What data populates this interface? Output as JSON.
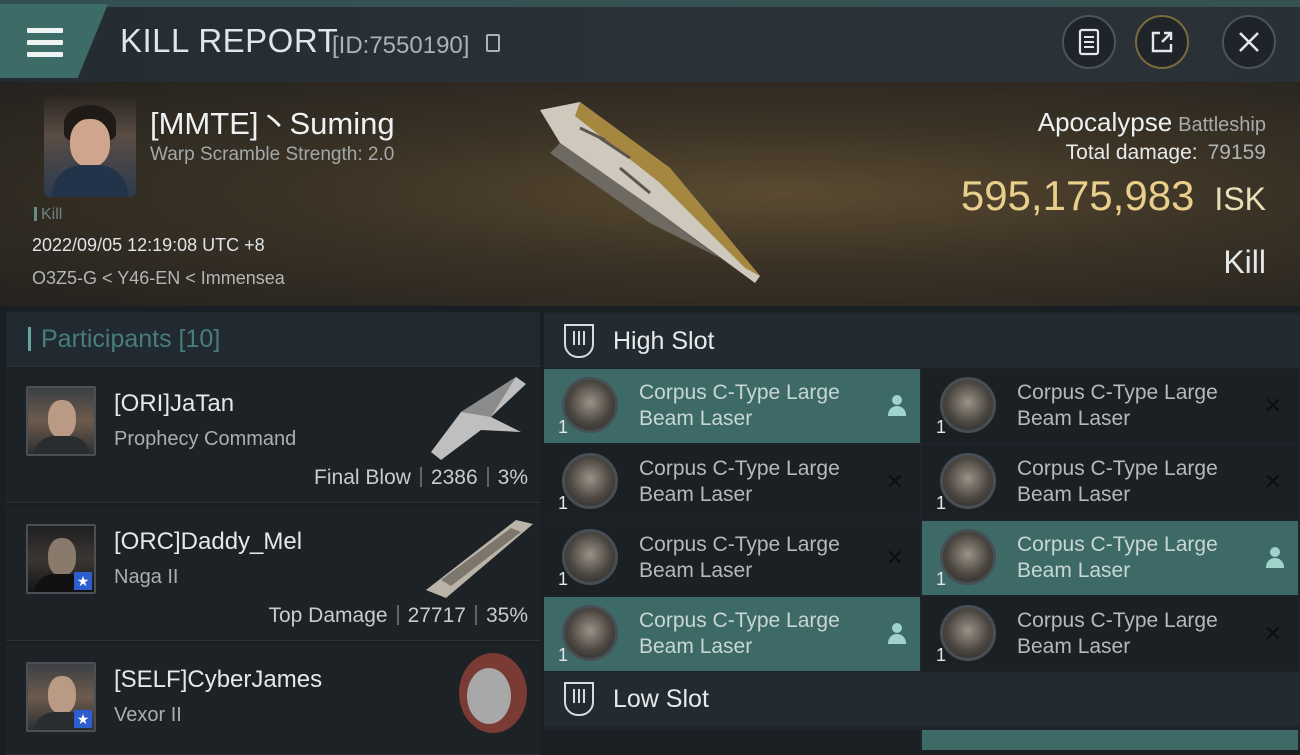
{
  "header": {
    "title": "KILL REPORT",
    "report_id": "[ID:7550190]",
    "icons": [
      "menu-icon",
      "copy-icon",
      "clipboard-icon",
      "share-icon",
      "close-icon"
    ]
  },
  "victim": {
    "name": "[MMTE]丶Suming",
    "warp_scramble": "Warp Scramble Strength: 2.0",
    "tag": "Kill",
    "datetime": "2022/09/05 12:19:08 UTC +8",
    "location": "O3Z5-G < Y46-EN < Immensea",
    "ship_name": "Apocalypse",
    "ship_class": "Battleship",
    "total_damage_label": "Total damage:",
    "total_damage": "79159",
    "isk_value": "595,175,983",
    "isk_unit": "ISK",
    "result": "Kill"
  },
  "participants": {
    "title": "Participants [10]",
    "list": [
      {
        "name": "[ORI]JaTan",
        "ship": "Prophecy Command",
        "role": "Final Blow",
        "damage": "2386",
        "percent": "3%"
      },
      {
        "name": "[ORC]Daddy_Mel",
        "ship": "Naga II",
        "role": "Top Damage",
        "damage": "27717",
        "percent": "35%"
      },
      {
        "name": "[SELF]CyberJames",
        "ship": "Vexor II"
      }
    ]
  },
  "slots": {
    "high_label": "High Slot",
    "low_label": "Low Slot",
    "qty": "1",
    "modules": [
      {
        "line1": "Corpus C-Type Large",
        "line2": "Beam Laser",
        "active": true
      },
      {
        "line1": "Corpus C-Type Large",
        "line2": "Beam Laser",
        "active": false
      },
      {
        "line1": "Corpus C-Type Large",
        "line2": "Beam Laser",
        "active": false
      },
      {
        "line1": "Corpus C-Type Large",
        "line2": "Beam Laser",
        "active": false
      },
      {
        "line1": "Corpus C-Type Large",
        "line2": "Beam Laser",
        "active": false
      },
      {
        "line1": "Corpus C-Type Large",
        "line2": "Beam Laser",
        "active": true
      },
      {
        "line1": "Corpus C-Type Large",
        "line2": "Beam Laser",
        "active": true
      },
      {
        "line1": "Corpus C-Type Large",
        "line2": "Beam Laser",
        "active": false
      }
    ],
    "status_icons": {
      "active": "person-icon",
      "inactive": "x-icon"
    },
    "x_glyph": "✕"
  },
  "colors": {
    "accent": "#3d6966",
    "isk": "#e9cf8c"
  }
}
